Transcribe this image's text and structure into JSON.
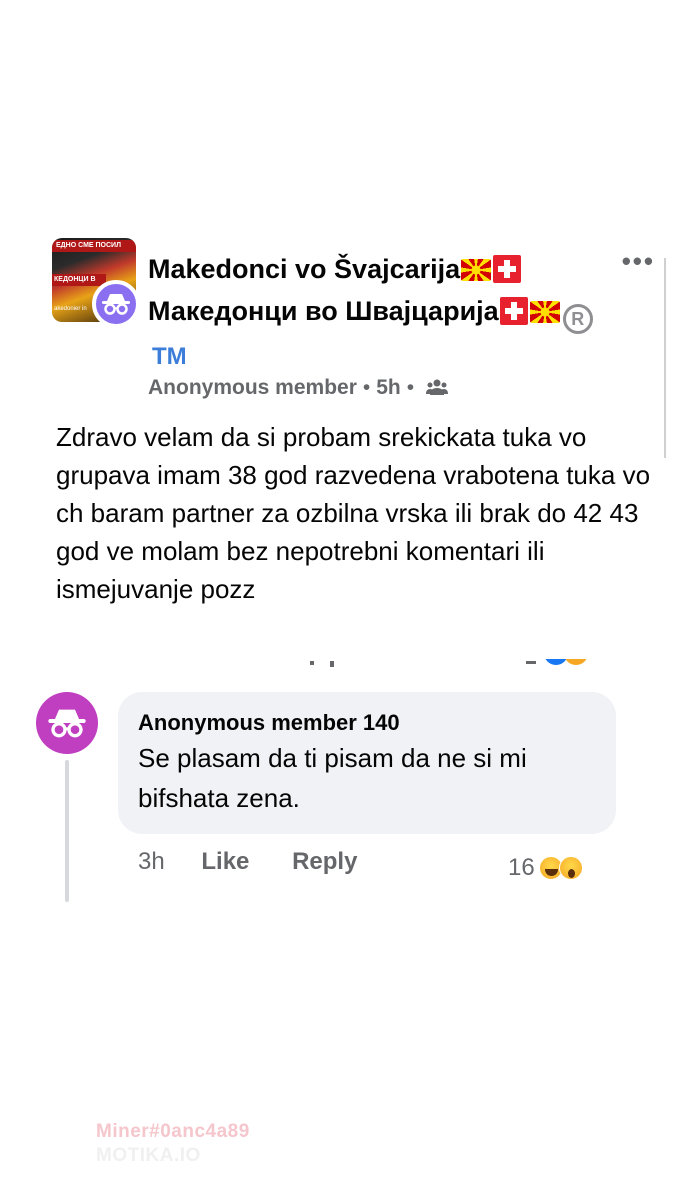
{
  "post": {
    "group_name_part1": "Makedonci vo Švajcarija",
    "group_name_part2": "Македонци во Швајцарија",
    "trademark": "TM",
    "registered_symbol": "R",
    "avatar_banner_top": "ЕДНО СМЕ ПОСИЛ",
    "avatar_banner_mid": "КЕДОНЦИ В",
    "avatar_banner_bot": "akedonier in",
    "author": "Anonymous member",
    "time": "5h",
    "privacy_icon": "group-members-icon",
    "more_icon": "ellipsis-icon",
    "body": "Zdravo velam da si probam srekickata tuka vo grupava imam 38 god razvedena vrabotena tuka vo ch baram partner za ozbilna vrska ili brak do 42 43 god ve molam bez nepotrebni komentari ili ismejuvanje pozz"
  },
  "comment": {
    "author": "Anonymous member 140",
    "text": "Se plasam da ti pisam da ne si mi bifshata zena.",
    "time": "3h",
    "like_label": "Like",
    "reply_label": "Reply",
    "reaction_count": "16",
    "reactions": [
      "laugh-emoji",
      "wow-emoji"
    ]
  },
  "watermark": {
    "line1": "Miner#0anc4a89",
    "line2": "MOTIKA.IO"
  },
  "colors": {
    "anon_badge": "#8a6ff0",
    "comment_avatar": "#c03ec0",
    "bubble": "#f0f2f5",
    "meta_text": "#65676b"
  }
}
